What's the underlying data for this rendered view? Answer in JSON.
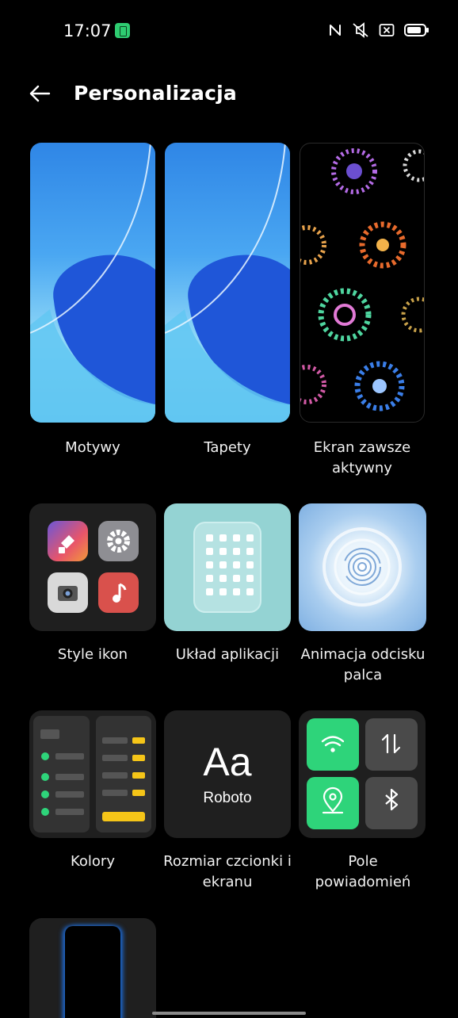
{
  "status_bar": {
    "time": "17:07",
    "icons": [
      "nfc-off-icon",
      "silent-icon",
      "sim-off-icon",
      "battery-icon"
    ]
  },
  "header": {
    "back_icon": "arrow-left-icon",
    "title": "Personalizacja"
  },
  "tiles": [
    {
      "label": "Motywy"
    },
    {
      "label": "Tapety"
    },
    {
      "label": "Ekran zawsze aktywny"
    },
    {
      "label": "Style ikon"
    },
    {
      "label": "Układ aplikacji"
    },
    {
      "label": "Animacja odcisku palca"
    },
    {
      "label": "Kolory"
    },
    {
      "label": "Rozmiar czcionki i ekranu",
      "preview_big": "Aa",
      "preview_font": "Roboto"
    },
    {
      "label": "Pole powiadomień"
    },
    {
      "label": ""
    }
  ],
  "colors": {
    "background": "#000000",
    "card": "#1f1f1f",
    "accent_green": "#2ed47a",
    "accent_yellow": "#f5c518"
  }
}
